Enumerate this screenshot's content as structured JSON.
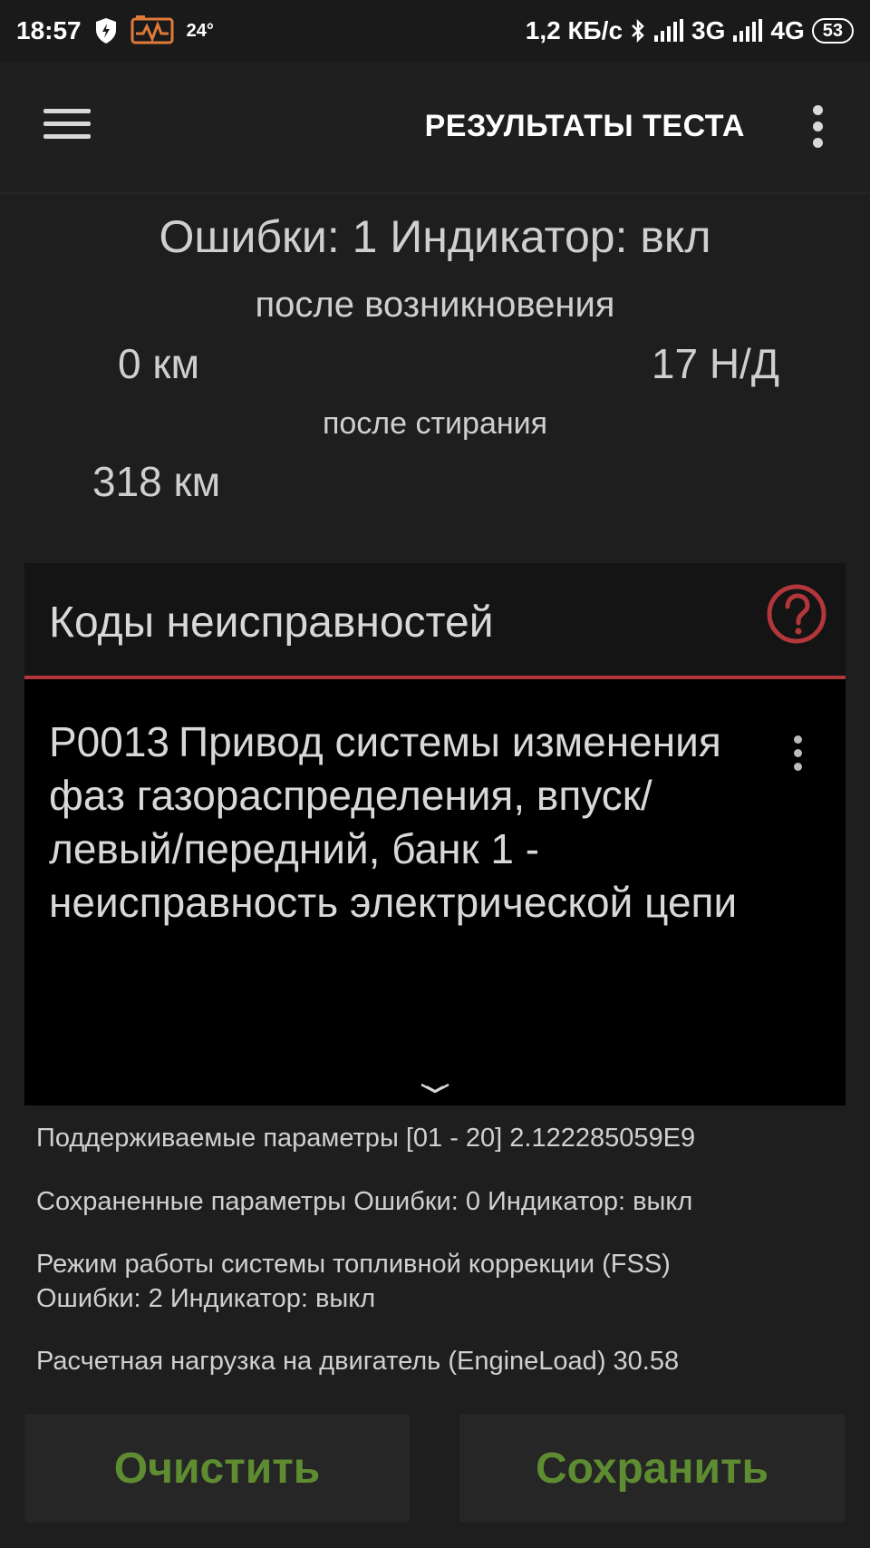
{
  "status_bar": {
    "time": "18:57",
    "temperature": "24°",
    "network_speed": "1,2 КБ/с",
    "net1": "3G",
    "net2": "4G",
    "battery": "53"
  },
  "app_bar": {
    "title": "РЕЗУЛЬТАТЫ ТЕСТА"
  },
  "summary": {
    "title": "Ошибки: 1 Индикатор: вкл",
    "after_occurrence_label": "после возникновения",
    "occurrence_km": "0 км",
    "occurrence_nd": "17 Н/Д",
    "after_erase_label": "после стирания",
    "erase_km": "318 км"
  },
  "codes_panel": {
    "title": "Коды неисправностей",
    "code": {
      "id": "P0013",
      "description": "Привод системы изменения фаз газораспределения, впуск/левый/передний, банк 1 - неисправность электрической цепи"
    }
  },
  "params": [
    {
      "text": "Поддерживаемые параметры [01 - 20] 2.122285059E9"
    },
    {
      "text": "Сохраненные параметры Ошибки: 0 Индикатор: выкл"
    },
    {
      "text": "Режим работы системы топливной коррекции (FSS)",
      "text2": "Ошибки: 2 Индикатор: выкл"
    },
    {
      "text": "Расчетная нагрузка на двигатель (EngineLoad) 30.58"
    }
  ],
  "buttons": {
    "clear_label": "Очистить",
    "save_label": "Сохранить"
  },
  "colors": {
    "accent_red": "#b3363a",
    "button_green": "#5e8c31",
    "obd_icon_orange": "#e07a3a"
  }
}
